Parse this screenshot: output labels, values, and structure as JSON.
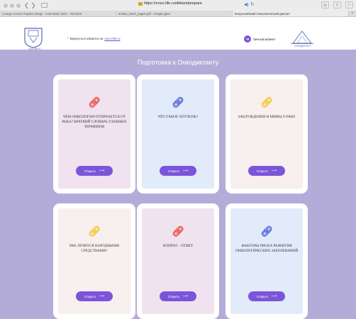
{
  "browser": {
    "url": "https://onco-life.ru/diktant/prepare",
    "tabs": [
      "Lounge Covers Popular Songs - Cool Music 2021 - YouTube",
      "anatsu_tosxn_pages.pdf - Google Диск",
      "Всероссийский Онкологический диктант"
    ]
  },
  "header": {
    "logo_caption": "onco-life.ru",
    "back_text": "Вернуться обратно на",
    "back_url": "onco-life.ru",
    "cabinet_label": "Личный кабинет",
    "dictant_caption": "ОНКОДИКТАНТ"
  },
  "main": {
    "title": "Подготовка к Онкодиктанту"
  },
  "cards": [
    {
      "text": "Чем онкология отличается от рака? Краткий словарь главных терминов",
      "button_label": "Открыть",
      "icon_color": "#e8463c",
      "bg": "#f1e2f0"
    },
    {
      "text": "Что такое опухоль?",
      "button_label": "Открыть",
      "icon_color": "#4a5bd4",
      "bg": "#e2ebfa"
    },
    {
      "text": "Заблуждения и мифы о раке",
      "button_label": "Открыть",
      "icon_color": "#f2c62d",
      "bg": "#f8efef"
    },
    {
      "text": "Рак лечится народными средствами?",
      "button_label": "Открыть",
      "icon_color": "#f2c62d",
      "bg": "#f8efef"
    },
    {
      "text": "Вопрос - ответ",
      "button_label": "Открыть",
      "icon_color": "#e8463c",
      "bg": "#f1e2f0"
    },
    {
      "text": "Факторы риска развития онкологических заболеваний",
      "button_label": "Открыть",
      "icon_color": "#4a5bd4",
      "bg": "#e2ebfa"
    }
  ]
}
